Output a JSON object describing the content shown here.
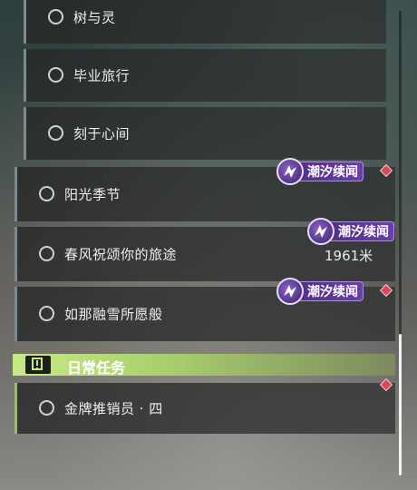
{
  "quests": [
    {
      "label": "树与灵"
    },
    {
      "label": "毕业旅行"
    },
    {
      "label": "刻于心间"
    },
    {
      "label": "阳光季节"
    },
    {
      "label": "春风祝颂你的旅途"
    },
    {
      "label": "如那融雪所愿般"
    },
    {
      "label": "金牌推销员 · 四"
    }
  ],
  "badges": [
    {
      "label": "潮汐续闻"
    },
    {
      "label": "潮汐续闻"
    },
    {
      "label": "潮汐续闻"
    }
  ],
  "distance": "1961米",
  "daily": {
    "title": "日常任务",
    "icon": "alert-icon"
  },
  "colors": {
    "accent_green": "#c6ea86",
    "badge_purple": "#6a3fa8",
    "marker_red": "#d9485a"
  },
  "scrollbar": {
    "position_fraction": 0.7
  }
}
